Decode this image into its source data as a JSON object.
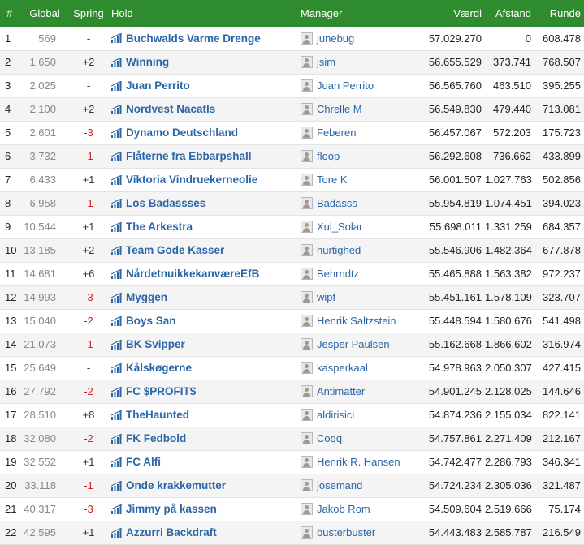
{
  "headers": {
    "rank": "#",
    "global": "Global",
    "spring": "Spring",
    "hold": "Hold",
    "manager": "Manager",
    "vaerdi": "Værdi",
    "afstand": "Afstand",
    "runde": "Runde"
  },
  "colors": {
    "header_bg": "#2e8b2e",
    "link": "#2a66a8",
    "negative": "#cc2222"
  },
  "rows": [
    {
      "rank": "1",
      "global": "569",
      "spring": "-",
      "hold": "Buchwalds Varme Drenge",
      "manager": "junebug",
      "vaerdi": "57.029.270",
      "afstand": "0",
      "runde": "608.478"
    },
    {
      "rank": "2",
      "global": "1.650",
      "spring": "+2",
      "hold": "Winning",
      "manager": "jsim",
      "vaerdi": "56.655.529",
      "afstand": "373.741",
      "runde": "768.507"
    },
    {
      "rank": "3",
      "global": "2.025",
      "spring": "-",
      "hold": "Juan Perrito",
      "manager": "Juan Perrito",
      "vaerdi": "56.565.760",
      "afstand": "463.510",
      "runde": "395.255"
    },
    {
      "rank": "4",
      "global": "2.100",
      "spring": "+2",
      "hold": "Nordvest Nacatls",
      "manager": "Chrelle M",
      "vaerdi": "56.549.830",
      "afstand": "479.440",
      "runde": "713.081"
    },
    {
      "rank": "5",
      "global": "2.601",
      "spring": "-3",
      "hold": "Dynamo Deutschland",
      "manager": "Feberen",
      "vaerdi": "56.457.067",
      "afstand": "572.203",
      "runde": "175.723"
    },
    {
      "rank": "6",
      "global": "3.732",
      "spring": "-1",
      "hold": "Flåterne fra Ebbarpshall",
      "manager": "floop",
      "vaerdi": "56.292.608",
      "afstand": "736.662",
      "runde": "433.899"
    },
    {
      "rank": "7",
      "global": "6.433",
      "spring": "+1",
      "hold": "Viktoria Vindruekerneolie",
      "manager": "Tore K",
      "vaerdi": "56.001.507",
      "afstand": "1.027.763",
      "runde": "502.856"
    },
    {
      "rank": "8",
      "global": "6.958",
      "spring": "-1",
      "hold": "Los Badassses",
      "manager": "Badasss",
      "vaerdi": "55.954.819",
      "afstand": "1.074.451",
      "runde": "394.023"
    },
    {
      "rank": "9",
      "global": "10.544",
      "spring": "+1",
      "hold": "The Arkestra",
      "manager": "Xul_Solar",
      "vaerdi": "55.698.011",
      "afstand": "1.331.259",
      "runde": "684.357"
    },
    {
      "rank": "10",
      "global": "13.185",
      "spring": "+2",
      "hold": "Team Gode Kasser",
      "manager": "hurtighed",
      "vaerdi": "55.546.906",
      "afstand": "1.482.364",
      "runde": "677.878"
    },
    {
      "rank": "11",
      "global": "14.681",
      "spring": "+6",
      "hold": "NårdetnuikkekanværeEfB",
      "manager": "Behrndtz",
      "vaerdi": "55.465.888",
      "afstand": "1.563.382",
      "runde": "972.237"
    },
    {
      "rank": "12",
      "global": "14.993",
      "spring": "-3",
      "hold": "Myggen",
      "manager": "wipf",
      "vaerdi": "55.451.161",
      "afstand": "1.578.109",
      "runde": "323.707"
    },
    {
      "rank": "13",
      "global": "15.040",
      "spring": "-2",
      "hold": "Boys San",
      "manager": "Henrik Saltzstein",
      "vaerdi": "55.448.594",
      "afstand": "1.580.676",
      "runde": "541.498"
    },
    {
      "rank": "14",
      "global": "21.073",
      "spring": "-1",
      "hold": "BK Svipper",
      "manager": "Jesper Paulsen",
      "vaerdi": "55.162.668",
      "afstand": "1.866.602",
      "runde": "316.974"
    },
    {
      "rank": "15",
      "global": "25.649",
      "spring": "-",
      "hold": "Kålskøgerne",
      "manager": "kasperkaal",
      "vaerdi": "54.978.963",
      "afstand": "2.050.307",
      "runde": "427.415"
    },
    {
      "rank": "16",
      "global": "27.792",
      "spring": "-2",
      "hold": "FC $PROFIT$",
      "manager": "Antimatter",
      "vaerdi": "54.901.245",
      "afstand": "2.128.025",
      "runde": "144.646"
    },
    {
      "rank": "17",
      "global": "28.510",
      "spring": "+8",
      "hold": "TheHaunted",
      "manager": "aldirisici",
      "vaerdi": "54.874.236",
      "afstand": "2.155.034",
      "runde": "822.141"
    },
    {
      "rank": "18",
      "global": "32.080",
      "spring": "-2",
      "hold": "FK Fedbold",
      "manager": "Coqq",
      "vaerdi": "54.757.861",
      "afstand": "2.271.409",
      "runde": "212.167"
    },
    {
      "rank": "19",
      "global": "32.552",
      "spring": "+1",
      "hold": "FC Alfi",
      "manager": "Henrik R. Hansen",
      "vaerdi": "54.742.477",
      "afstand": "2.286.793",
      "runde": "346.341"
    },
    {
      "rank": "20",
      "global": "33.118",
      "spring": "-1",
      "hold": "Onde krakkemutter",
      "manager": "josemand",
      "vaerdi": "54.724.234",
      "afstand": "2.305.036",
      "runde": "321.487"
    },
    {
      "rank": "21",
      "global": "40.317",
      "spring": "-3",
      "hold": "Jimmy på kassen",
      "manager": "Jakob Rom",
      "vaerdi": "54.509.604",
      "afstand": "2.519.666",
      "runde": "75.174"
    },
    {
      "rank": "22",
      "global": "42.595",
      "spring": "+1",
      "hold": "Azzurri Backdraft",
      "manager": "busterbuster",
      "vaerdi": "54.443.483",
      "afstand": "2.585.787",
      "runde": "216.549"
    }
  ]
}
